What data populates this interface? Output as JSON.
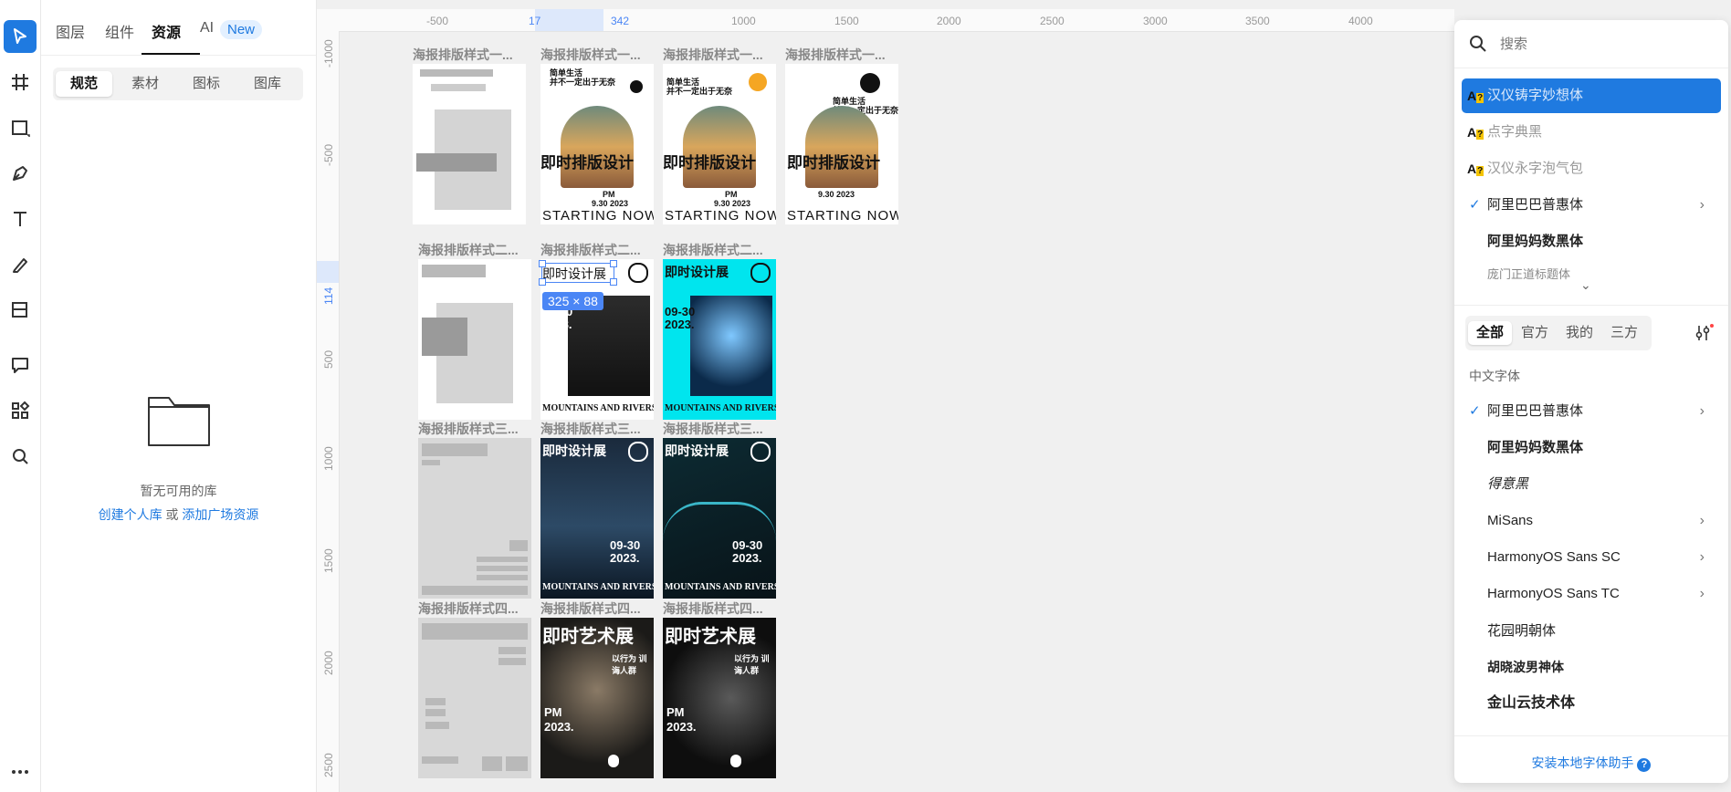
{
  "left_tabs": {
    "layers": "图层",
    "components": "组件",
    "assets": "资源",
    "ai": "AI",
    "new_badge": "New"
  },
  "sub_tabs": [
    "规范",
    "素材",
    "图标",
    "图库"
  ],
  "empty_state": {
    "message": "暂无可用的库",
    "link_personal": "创建个人库",
    "or": "或",
    "link_square": "添加广场资源"
  },
  "ruler_x": [
    "-500",
    "17",
    "342",
    "1000",
    "1500",
    "2000",
    "2500",
    "3000",
    "3500",
    "4000"
  ],
  "ruler_y": [
    "-1000",
    "-500",
    "114",
    "500",
    "1000",
    "1500",
    "2000",
    "2500"
  ],
  "frames": {
    "row1_title": "海报排版样式一...",
    "row2_title": "海报排版样式二...",
    "row3_title": "海报排版样式三...",
    "row4_title": "海报排版样式四..."
  },
  "posters": {
    "r1_headline": "即时排版设计",
    "r1_tagline1": "简单生活",
    "r1_tagline2": "并不一定出于无奈",
    "r1_date": "9.30 2023",
    "r1_pm": "PM",
    "r1_footer": "STARTING NOW",
    "r2_title": "即时设计展",
    "r2_date": "09-30",
    "r2_year": "2023.",
    "r2_footer": "MOUNTAINS AND RIVERS",
    "r4_title": "即时艺术展",
    "r4_sub": "以行为 训诲人群",
    "r4_pm": "PM",
    "r4_year": "2023."
  },
  "selection_size": "325 × 88",
  "search": {
    "placeholder": "搜索"
  },
  "recent_fonts": [
    {
      "name": "汉仪铸字妙想体",
      "preview": "A?",
      "selected": true
    },
    {
      "name": "点字典黑",
      "preview": "A?"
    },
    {
      "name": "汉仪永字泡气包",
      "preview": "A?"
    },
    {
      "name": "阿里巴巴普惠体",
      "checked": true,
      "has_sub": true
    },
    {
      "name": "阿里妈妈数黑体"
    },
    {
      "name": "庞门正道标题体"
    }
  ],
  "font_tabs": [
    "全部",
    "官方",
    "我的",
    "三方"
  ],
  "section_title": "中文字体",
  "fonts": [
    {
      "name": "阿里巴巴普惠体",
      "checked": true,
      "has_sub": true
    },
    {
      "name": "阿里妈妈数黑体"
    },
    {
      "name": "得意黑"
    },
    {
      "name": "MiSans",
      "has_sub": true
    },
    {
      "name": "HarmonyOS Sans SC",
      "has_sub": true
    },
    {
      "name": "HarmonyOS Sans TC",
      "has_sub": true
    },
    {
      "name": "花园明朝体"
    },
    {
      "name": "胡晓波男神体"
    },
    {
      "name": "金山云技术体"
    }
  ],
  "install_helper": "安装本地字体助手"
}
